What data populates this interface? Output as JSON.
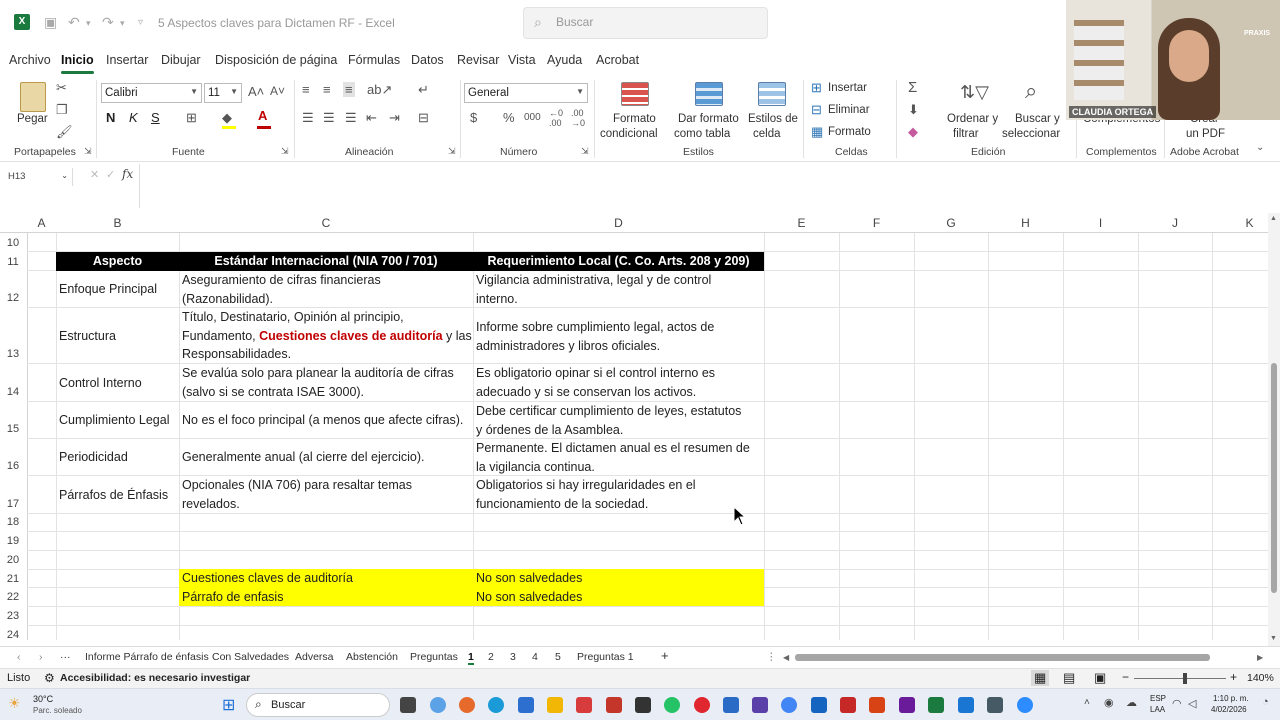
{
  "app": {
    "title": "5 Aspectos claves para Dictamen RF  -  Excel",
    "search_placeholder": "Buscar"
  },
  "menu": [
    "Archivo",
    "Inicio",
    "Insertar",
    "Dibujar",
    "Disposición de página",
    "Fórmulas",
    "Datos",
    "Revisar",
    "Vista",
    "Ayuda",
    "Acrobat"
  ],
  "ribbon": {
    "paste": "Pegar",
    "portapapeles": "Portapapeles",
    "font_name": "Calibri",
    "font_size": "11",
    "fuente": "Fuente",
    "alineacion": "Alineación",
    "number_format": "General",
    "numero": "Número",
    "formato_condicional_1": "Formato",
    "formato_condicional_2": "condicional",
    "dar_formato_1": "Dar formato",
    "dar_formato_2": "como tabla",
    "estilos_celda_1": "Estilos de",
    "estilos_celda_2": "celda",
    "estilos": "Estilos",
    "insertar": "Insertar",
    "eliminar": "Eliminar",
    "formato": "Formato",
    "celdas": "Celdas",
    "ordenar_1": "Ordenar y",
    "ordenar_2": "filtrar",
    "buscar_1": "Buscar y",
    "buscar_2": "seleccionar",
    "edicion": "Edición",
    "complementos_btn": "Complementos",
    "complementos": "Complementos",
    "crear_pdf_1": "Crear",
    "crear_pdf_2": "un PDF",
    "adobe": "Adobe Acrobat"
  },
  "formula_bar": {
    "name_box": "H13",
    "fx": "fx"
  },
  "columns": [
    "A",
    "B",
    "C",
    "D",
    "E",
    "F",
    "G",
    "H",
    "I",
    "J",
    "K"
  ],
  "rows": [
    "10",
    "11",
    "12",
    "13",
    "14",
    "15",
    "16",
    "17",
    "18",
    "19",
    "20",
    "21",
    "22",
    "23",
    "24"
  ],
  "table": {
    "headers": [
      "Aspecto",
      "Estándar Internacional (NIA 700 / 701)",
      "Requerimiento Local (C. Co. Arts. 208 y 209)"
    ],
    "r12": {
      "b": "Enfoque Principal",
      "c1": "Aseguramiento de cifras financieras",
      "c2": "(Razonabilidad).",
      "d1": "Vigilancia administrativa, legal y de control",
      "d2": "interno."
    },
    "r13": {
      "b": "Estructura",
      "c1": "Título, Destinatario, Opinión al principio,",
      "c2a": "Fundamento, ",
      "c2b": "Cuestiones claves de auditoría",
      "c2c": " y las",
      "c3": "Responsabilidades.",
      "d1": "Informe sobre cumplimiento legal, actos de",
      "d2": "administradores y libros oficiales."
    },
    "r14": {
      "b": "Control Interno",
      "c1": "Se evalúa solo para planear la auditoría de cifras",
      "c2": "(salvo si se contrata ISAE 3000).",
      "d1": "Es obligatorio opinar si el control interno es",
      "d2": "adecuado y si se conservan los activos."
    },
    "r15": {
      "b": "Cumplimiento Legal",
      "c1": "No es el foco principal (a menos que afecte cifras).",
      "d1": "Debe certificar cumplimiento de leyes, estatutos",
      "d2": "y órdenes de la Asamblea."
    },
    "r16": {
      "b": "Periodicidad",
      "c1": "Generalmente anual (al cierre del ejercicio).",
      "d1": "Permanente. El dictamen anual es el resumen de",
      "d2": "la vigilancia continua."
    },
    "r17": {
      "b": "Párrafos de Énfasis",
      "c1": "Opcionales (NIA 706) para resaltar temas",
      "c2": "revelados.",
      "d1": "Obligatorios si hay irregularidades en el",
      "d2": "funcionamiento de la sociedad."
    },
    "r21": {
      "c": "Cuestiones claves de auditoría",
      "d": "No son salvedades"
    },
    "r22": {
      "c": "Párrafo de enfasis",
      "d": "No son salvedades"
    }
  },
  "sheet_tabs": [
    "Informe Párrafo de énfasis",
    "Con Salvedades",
    "Adversa",
    "Abstención",
    "Preguntas",
    "1",
    "2",
    "3",
    "4",
    "5",
    "Preguntas 1"
  ],
  "active_tab": "1",
  "status": {
    "ready": "Listo",
    "accessibility": "Accesibilidad: es necesario investigar",
    "zoom": "140%"
  },
  "taskbar": {
    "weather_temp": "30°C",
    "weather_desc": "Parc. soleado",
    "search": "Buscar",
    "lang_1": "ESP",
    "lang_2": "LAA",
    "time": "1:10 p. m.",
    "date": "4/02/2026"
  },
  "camera": {
    "name": "CLAUDIA ORTEGA",
    "logo": "PRAXIS"
  },
  "colors": {
    "excel_green": "#1b7a3e",
    "highlight": "#ffff00",
    "red_text": "#c00000"
  }
}
